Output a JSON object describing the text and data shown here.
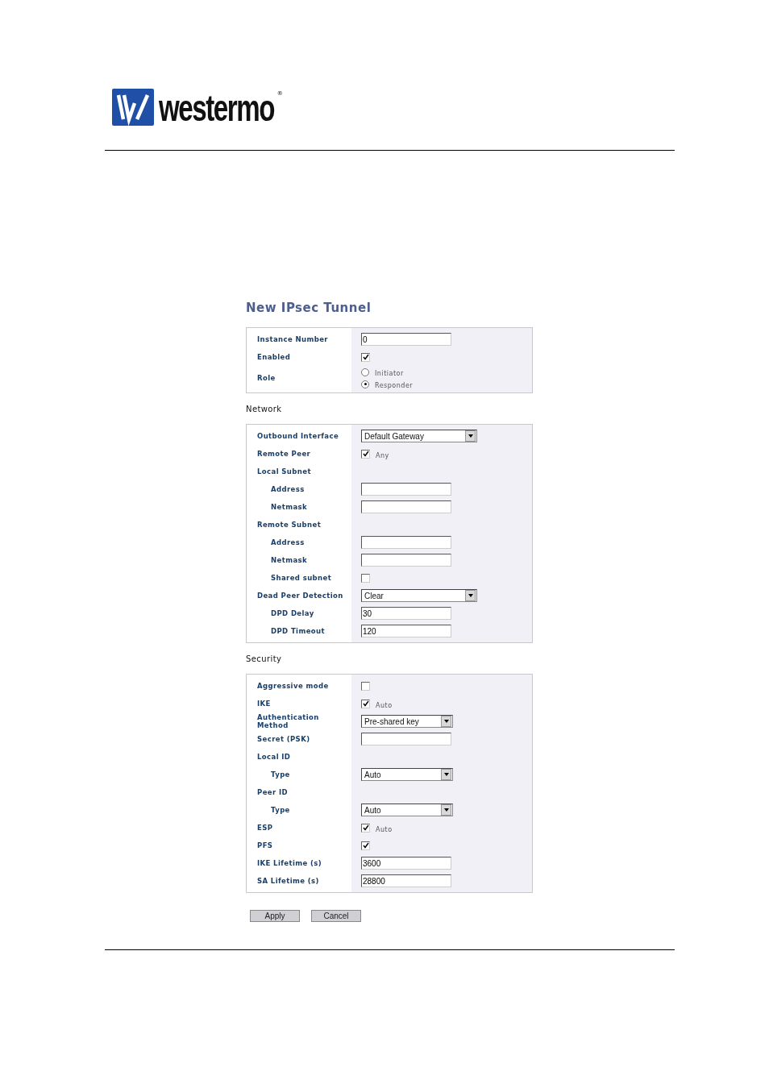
{
  "logo": {
    "wordmark": "westermo",
    "registered": "®"
  },
  "title": "New IPsec Tunnel",
  "panels": [
    {
      "rows": [
        {
          "label": "Instance Number",
          "field": {
            "kind": "text",
            "value": "0"
          }
        },
        {
          "label": "Enabled",
          "field": {
            "kind": "checkbox",
            "checked": true
          }
        },
        {
          "label": "Role",
          "field": {
            "kind": "radio",
            "options": [
              {
                "label": "Initiator",
                "selected": false
              },
              {
                "label": "Responder",
                "selected": true
              }
            ]
          }
        }
      ]
    },
    {
      "heading": "Network",
      "rows": [
        {
          "label": "Outbound Interface",
          "field": {
            "kind": "select",
            "value": "Default Gateway",
            "wide": true
          }
        },
        {
          "label": "Remote Peer",
          "field": {
            "kind": "checkbox",
            "checked": true,
            "text": "Any"
          }
        },
        {
          "label": "Local Subnet",
          "children": [
            {
              "label": "Address",
              "field": {
                "kind": "text"
              }
            },
            {
              "label": "Netmask",
              "field": {
                "kind": "text"
              }
            }
          ]
        },
        {
          "label": "Remote Subnet",
          "children": [
            {
              "label": "Address",
              "field": {
                "kind": "text"
              }
            },
            {
              "label": "Netmask",
              "field": {
                "kind": "text"
              }
            },
            {
              "label": "Shared subnet",
              "field": {
                "kind": "checkbox",
                "checked": false
              }
            }
          ]
        },
        {
          "label": "Dead Peer Detection",
          "field": {
            "kind": "select",
            "value": "Clear",
            "wide": true
          },
          "children": [
            {
              "label": "DPD Delay",
              "field": {
                "kind": "text",
                "value": "30"
              }
            },
            {
              "label": "DPD Timeout",
              "field": {
                "kind": "text",
                "value": "120"
              }
            }
          ]
        }
      ]
    },
    {
      "heading": "Security",
      "rows": [
        {
          "label": "Aggressive mode",
          "field": {
            "kind": "checkbox",
            "checked": false
          }
        },
        {
          "label": "IKE",
          "field": {
            "kind": "checkbox",
            "checked": true,
            "text": "Auto"
          }
        },
        {
          "label": "Authentication Method",
          "field": {
            "kind": "select",
            "value": "Pre-shared key",
            "wide": false
          }
        },
        {
          "label": "Secret (PSK)",
          "field": {
            "kind": "text"
          }
        },
        {
          "label": "Local ID",
          "children": [
            {
              "label": "Type",
              "field": {
                "kind": "select",
                "value": "Auto",
                "wide": false
              }
            }
          ]
        },
        {
          "label": "Peer ID",
          "children": [
            {
              "label": "Type",
              "field": {
                "kind": "select",
                "value": "Auto",
                "wide": false
              }
            }
          ]
        },
        {
          "label": "ESP",
          "field": {
            "kind": "checkbox",
            "checked": true,
            "text": "Auto"
          }
        },
        {
          "label": "PFS",
          "field": {
            "kind": "checkbox",
            "checked": true
          }
        },
        {
          "label": "IKE Lifetime (s)",
          "field": {
            "kind": "text",
            "value": "3600"
          }
        },
        {
          "label": "SA Lifetime (s)",
          "field": {
            "kind": "text",
            "value": "28800"
          }
        }
      ]
    }
  ],
  "buttons": [
    "Apply",
    "Cancel"
  ]
}
